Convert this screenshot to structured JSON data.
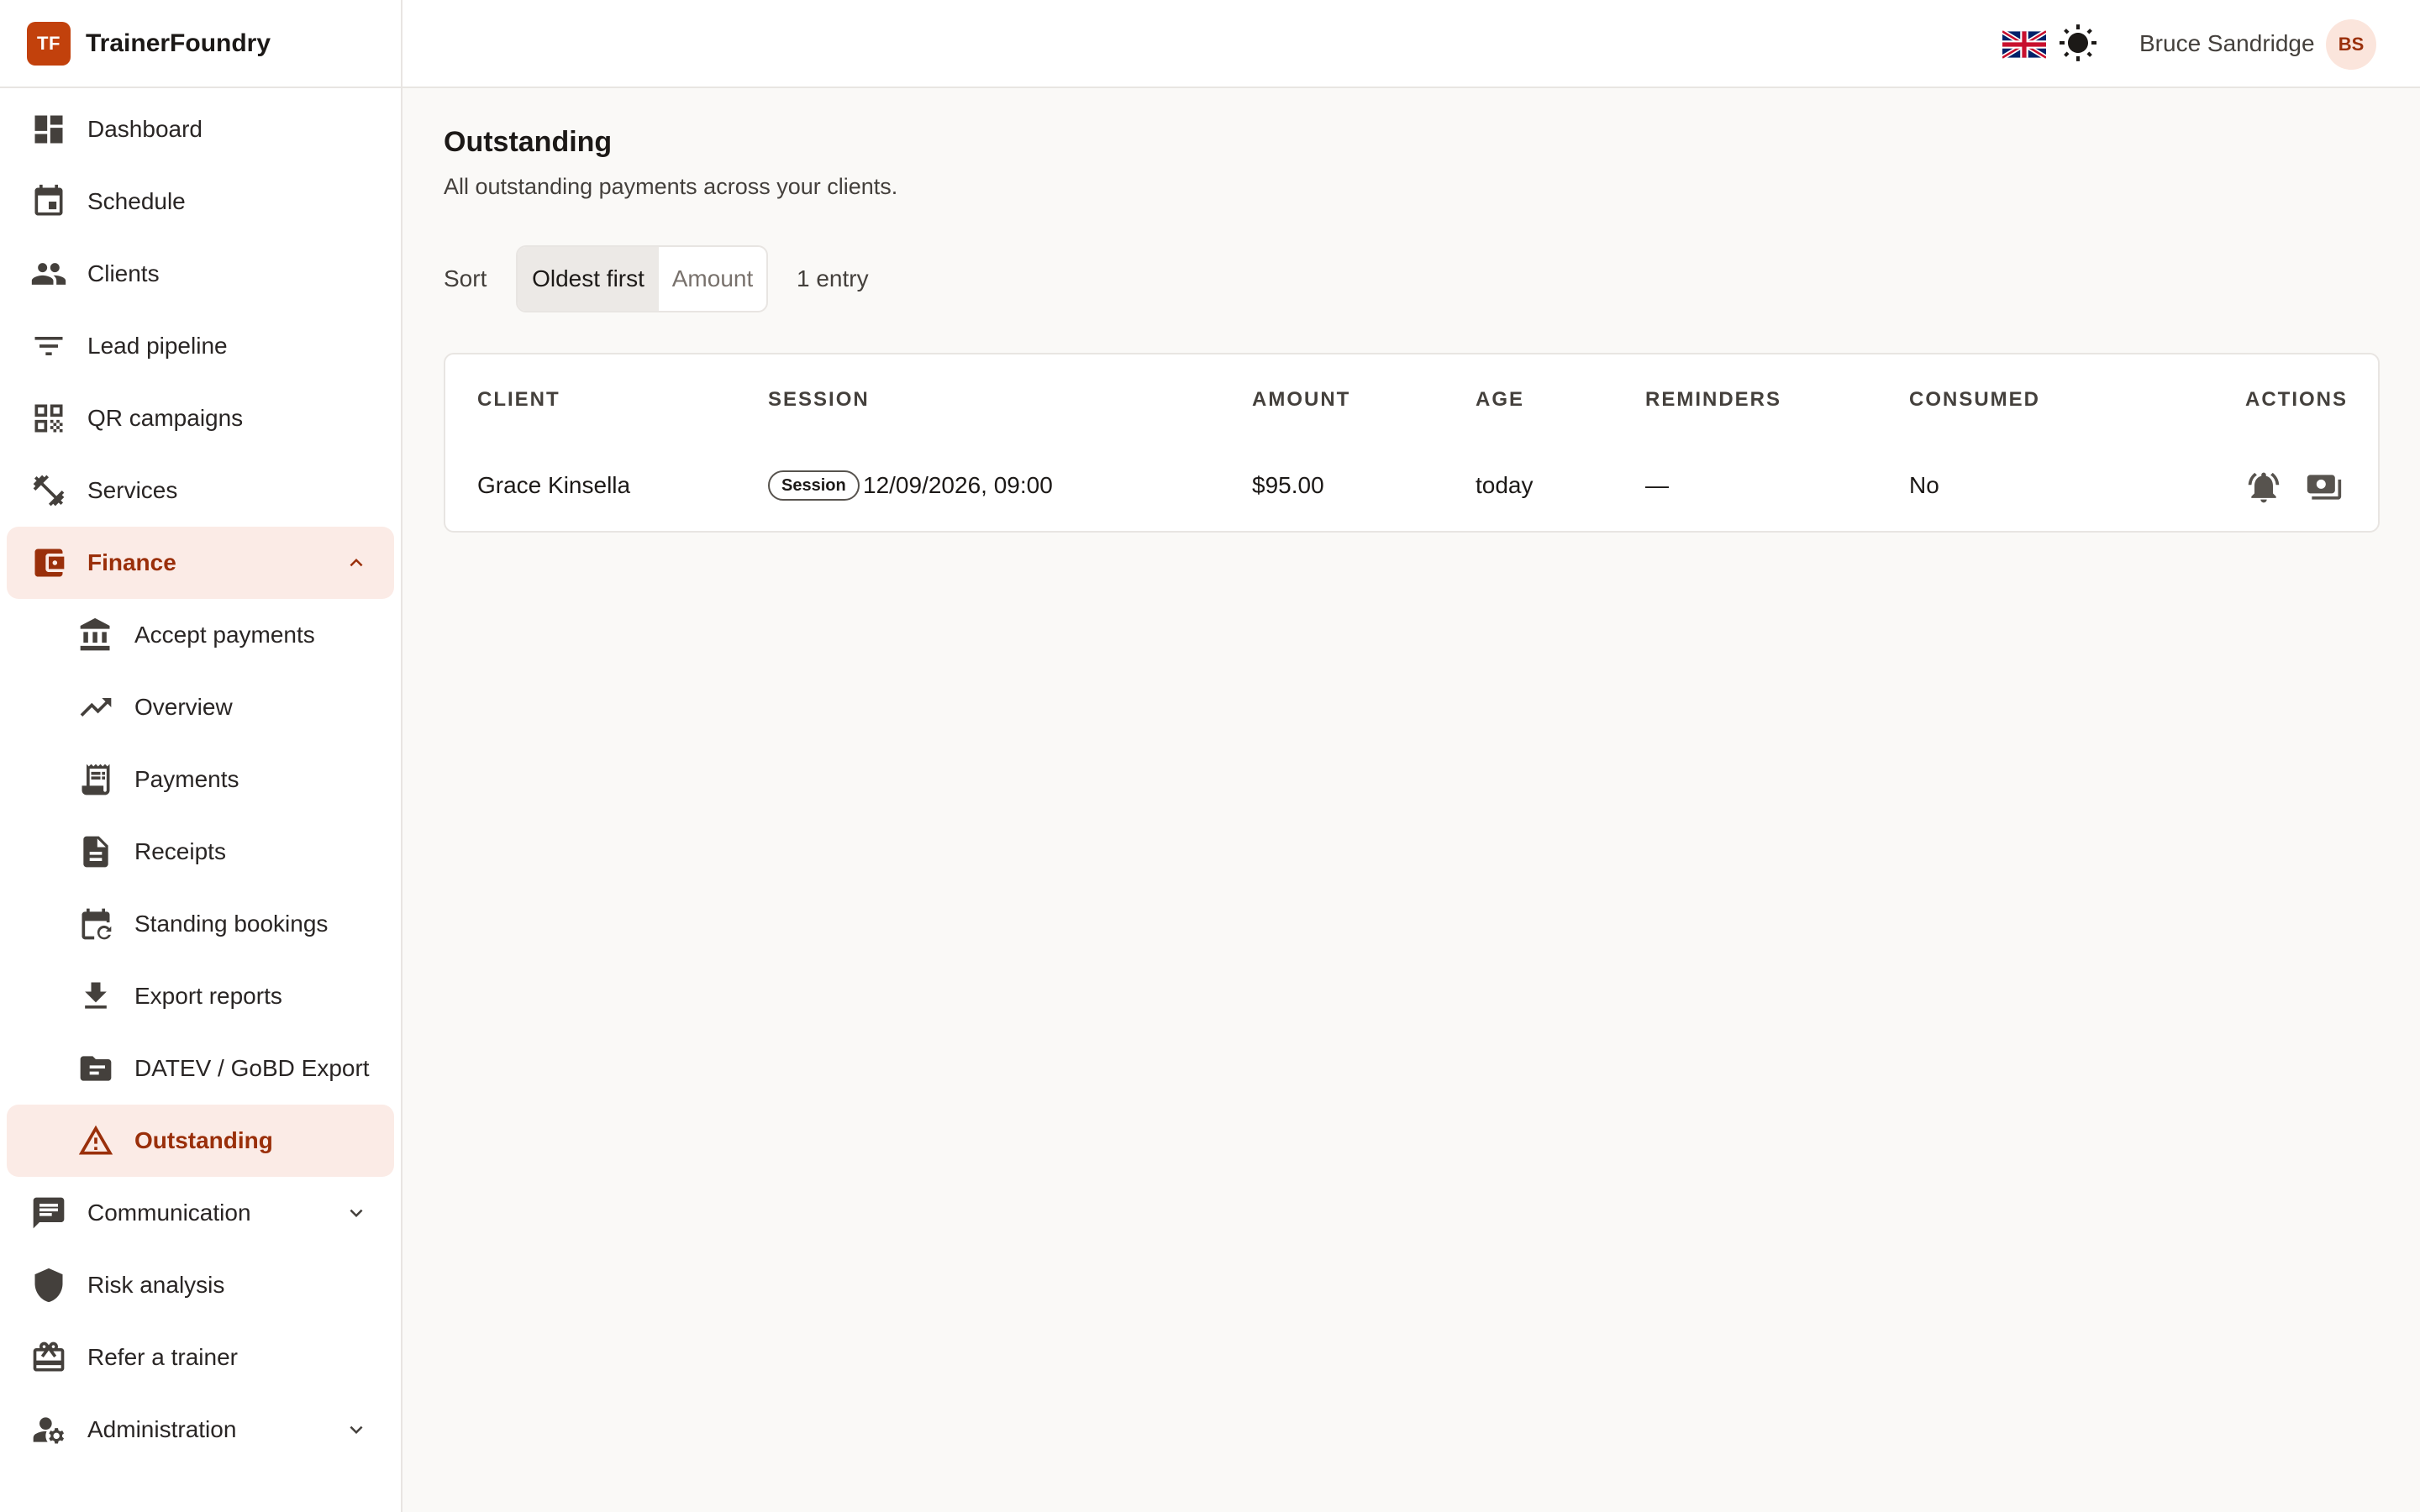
{
  "brand": {
    "logo": "TF",
    "name": "TrainerFoundry"
  },
  "sidebar": {
    "items": [
      {
        "label": "Dashboard",
        "icon": "dashboard-icon"
      },
      {
        "label": "Schedule",
        "icon": "calendar-icon"
      },
      {
        "label": "Clients",
        "icon": "people-icon"
      },
      {
        "label": "Lead pipeline",
        "icon": "filter-icon"
      },
      {
        "label": "QR campaigns",
        "icon": "qr-code-icon"
      },
      {
        "label": "Services",
        "icon": "dumbbell-icon"
      },
      {
        "label": "Finance",
        "icon": "wallet-icon",
        "expanded": true
      },
      {
        "label": "Accept payments",
        "icon": "bank-icon"
      },
      {
        "label": "Overview",
        "icon": "trending-up-icon"
      },
      {
        "label": "Payments",
        "icon": "receipt-long-icon"
      },
      {
        "label": "Receipts",
        "icon": "document-icon"
      },
      {
        "label": "Standing bookings",
        "icon": "calendar-repeat-icon"
      },
      {
        "label": "Export reports",
        "icon": "download-icon"
      },
      {
        "label": "DATEV / GoBD Export",
        "icon": "folder-icon"
      },
      {
        "label": "Outstanding",
        "icon": "warning-icon",
        "active": true
      },
      {
        "label": "Communication",
        "icon": "chat-icon"
      },
      {
        "label": "Risk analysis",
        "icon": "shield-icon"
      },
      {
        "label": "Refer a trainer",
        "icon": "gift-card-icon"
      },
      {
        "label": "Administration",
        "icon": "admin-settings-icon"
      }
    ]
  },
  "header": {
    "language_icon": "uk-flag-icon",
    "theme_icon": "sun-icon",
    "user_name": "Bruce Sandridge",
    "user_initials": "BS"
  },
  "main": {
    "title": "Outstanding",
    "subtitle": "All outstanding payments across your clients.",
    "sort_label": "Sort",
    "sort_options": [
      "Oldest first",
      "Amount"
    ],
    "sort_selected": "Oldest first",
    "entry_count": "1 entry"
  },
  "table": {
    "headers": [
      "CLIENT",
      "SESSION",
      "AMOUNT",
      "AGE",
      "REMINDERS",
      "CONSUMED",
      "ACTIONS"
    ],
    "rows": [
      {
        "client": "Grace Kinsella",
        "session_badge": "Session",
        "session_datetime": "12/09/2026, 09:00",
        "amount": "$95.00",
        "age": "today",
        "reminders": "—",
        "consumed": "No",
        "actions": [
          "send-reminder-icon",
          "record-payment-icon"
        ]
      }
    ]
  },
  "colors": {
    "accent": "#c2410c",
    "active_bg": "#fbebe6",
    "active_text": "#9a2f0a",
    "background": "#faf9f7"
  }
}
